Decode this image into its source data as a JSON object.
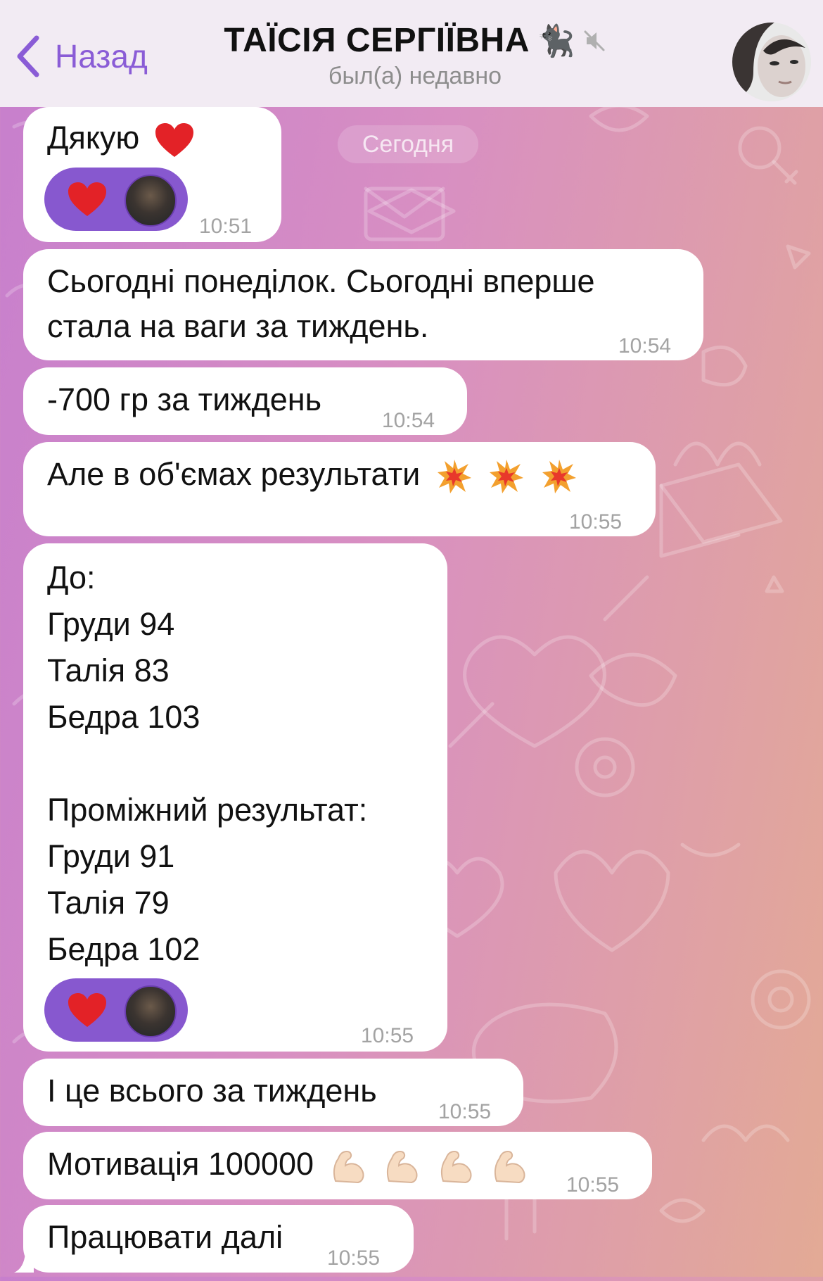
{
  "header": {
    "back_label": "Назад",
    "title": "ТАЇСІЯ СЕРГІЇВНА",
    "title_emoji": "🐈‍⬛",
    "status": "был(а) недавно"
  },
  "date_separator": "Сегодня",
  "messages": [
    {
      "text": "Дякую",
      "time": "10:51",
      "reaction": "❤️"
    },
    {
      "text": "Сьогодні понеділок. Сьогодні вперше\nстала на ваги за тиждень.",
      "time": "10:54"
    },
    {
      "text": "-700 гр за тиждень",
      "time": "10:54"
    },
    {
      "text": "Але в об'ємах результати",
      "time": "10:55",
      "emoji": "💥💥💥"
    },
    {
      "text": "До:\nГруди 94\nТалія 83\nБедра 103\n\nПроміжний результат:\nГруди 91\nТалія 79\nБедра 102",
      "time": "10:55",
      "reaction": "❤️"
    },
    {
      "text": "І це всього за тиждень",
      "time": "10:55"
    },
    {
      "text": "Мотивація 100000",
      "time": "10:55",
      "emoji": "💪🏻💪🏻💪🏻💪🏻"
    },
    {
      "text": "Працювати далі",
      "time": "10:55"
    }
  ],
  "colors": {
    "accent": "#8a5cd6",
    "reaction_bg": "#8758cf",
    "bubble": "#ffffff"
  }
}
